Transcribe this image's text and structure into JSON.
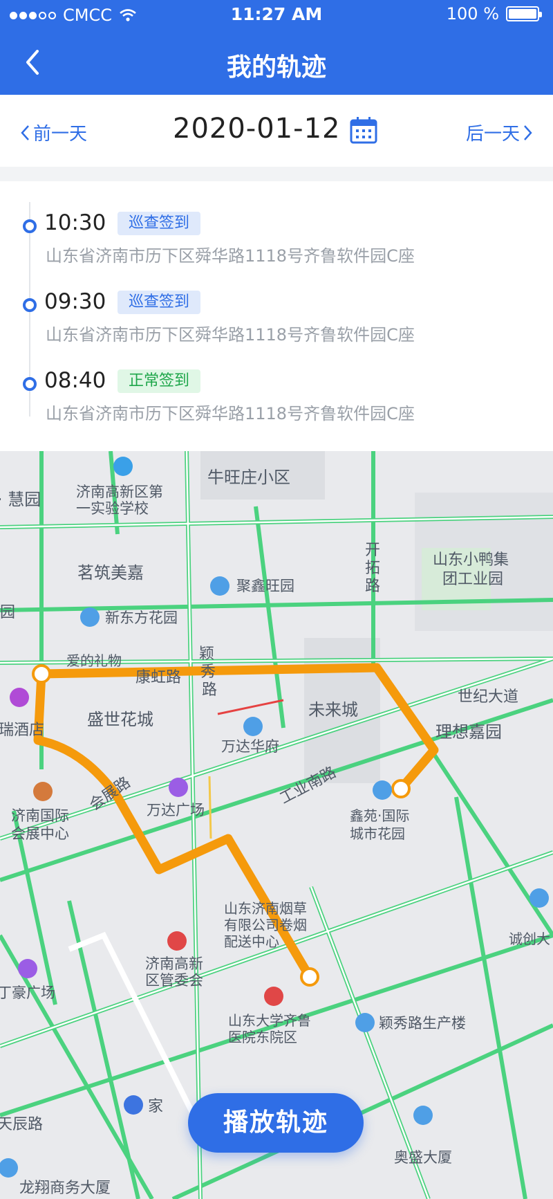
{
  "status_bar": {
    "carrier": "CMCC",
    "time": "11:27 AM",
    "battery": "100 %"
  },
  "header": {
    "title": "我的轨迹",
    "back_icon": "chevron-left-icon"
  },
  "date_bar": {
    "prev_label": "前一天",
    "next_label": "后一天",
    "date": "2020-01-12",
    "calendar_icon": "calendar-icon"
  },
  "records": [
    {
      "time": "10:30",
      "type": "巡查签到",
      "status_color": "blue",
      "address": "山东省济南市历下区舜华路1118号齐鲁软件园C座"
    },
    {
      "time": "09:30",
      "type": "巡查签到",
      "status_color": "blue",
      "address": "山东省济南市历下区舜华路1118号齐鲁软件园C座"
    },
    {
      "time": "08:40",
      "type": "正常签到",
      "status_color": "green",
      "address": "山东省济南市历下区舜华路1118号齐鲁软件园C座"
    }
  ],
  "map": {
    "labels": {
      "niuwangzhuang": "牛旺庄小区",
      "huiyuan": "· 慧园",
      "school": "济南高新区第一实验学校",
      "mingzhu": "茗筑美嘉",
      "juxinwang": "聚鑫旺园",
      "xindongfang": "新东方花园",
      "aidelipin": "爱的礼物",
      "kanghong": "康虹路",
      "shengshi": "盛世花城",
      "weilai": "未来城",
      "xiaoya": "山东小鸭集团工业园",
      "shiji": "世纪大道",
      "lixiang": "理想嘉园",
      "wanda_hf": "万达华府",
      "gongyenan": "工业南路",
      "huizhan_road": "会展路",
      "wanda_gc": "万达广场",
      "xinyuan": "鑫苑·国际城市花园",
      "huizhan": "济南国际会展中心",
      "yancao": "山东济南烟草有限公司卷烟配送中心",
      "guanwei": "济南高新区管委会",
      "hospital": "山东大学齐鲁医院东院区",
      "yingxiu_bldg": "颖秀路生产楼",
      "chengxin": "诚创大",
      "dinghao": "丁豪广场",
      "tianchen": "天辰路",
      "home": "家",
      "aosheng": "奥盛大厦",
      "longxiang": "龙翔商务大厦",
      "ruijiudian": "瑞酒店",
      "kaituo": "开拓路",
      "yingxiu_road": "颖秀路",
      "yuan_left": "园"
    },
    "route_color": "#f59a0c",
    "road_color": "#43d17a"
  },
  "play_button": "播放轨迹"
}
